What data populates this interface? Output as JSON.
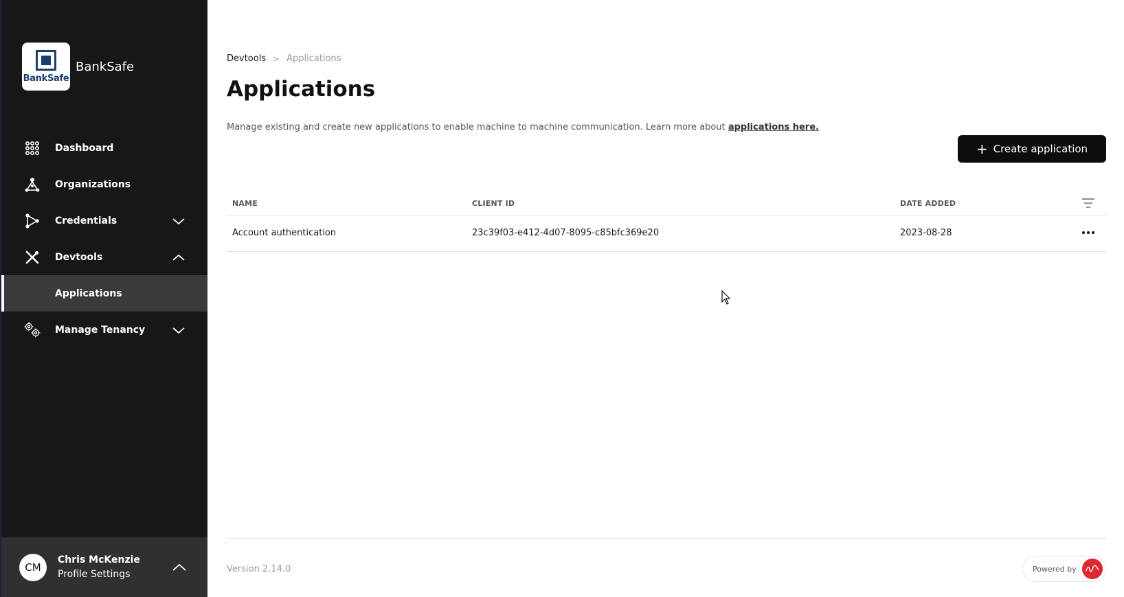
{
  "brand": {
    "logo_text": "BankSafe",
    "name": "BankSafe"
  },
  "nav": {
    "items": [
      {
        "label": "Dashboard",
        "icon": "grid-icon"
      },
      {
        "label": "Organizations",
        "icon": "organization-icon"
      },
      {
        "label": "Credentials",
        "icon": "credentials-icon",
        "chevron": "down"
      },
      {
        "label": "Devtools",
        "icon": "tools-icon",
        "chevron": "up"
      },
      {
        "label": "Applications",
        "sub": true,
        "active": true
      },
      {
        "label": "Manage Tenancy",
        "icon": "gears-icon",
        "chevron": "down"
      }
    ]
  },
  "profile": {
    "initials": "CM",
    "name": "Chris McKenzie",
    "subtitle": "Profile Settings"
  },
  "breadcrumb": {
    "parent": "Devtools",
    "separator": ">",
    "current": "Applications"
  },
  "page": {
    "title": "Applications",
    "description": "Manage existing and create new applications to enable machine to machine communication. Learn more about ",
    "description_link": "applications here.",
    "create_button": "Create application"
  },
  "table": {
    "columns": [
      "NAME",
      "CLIENT ID",
      "DATE ADDED"
    ],
    "rows": [
      {
        "name": "Account authentication",
        "client_id": "23c39f03-e412-4d07-8095-c85bfc369e20",
        "date_added": "2023-08-28"
      }
    ]
  },
  "footer": {
    "version": "Version 2.14.0",
    "powered_by": "Powered by"
  },
  "colors": {
    "sidebar": "#171717",
    "active_item": "#3a3a3a",
    "profile_bg": "#303030",
    "button": "#0d0d0d",
    "brand_blue": "#1d3d6e",
    "powered_red": "#e0262e"
  }
}
